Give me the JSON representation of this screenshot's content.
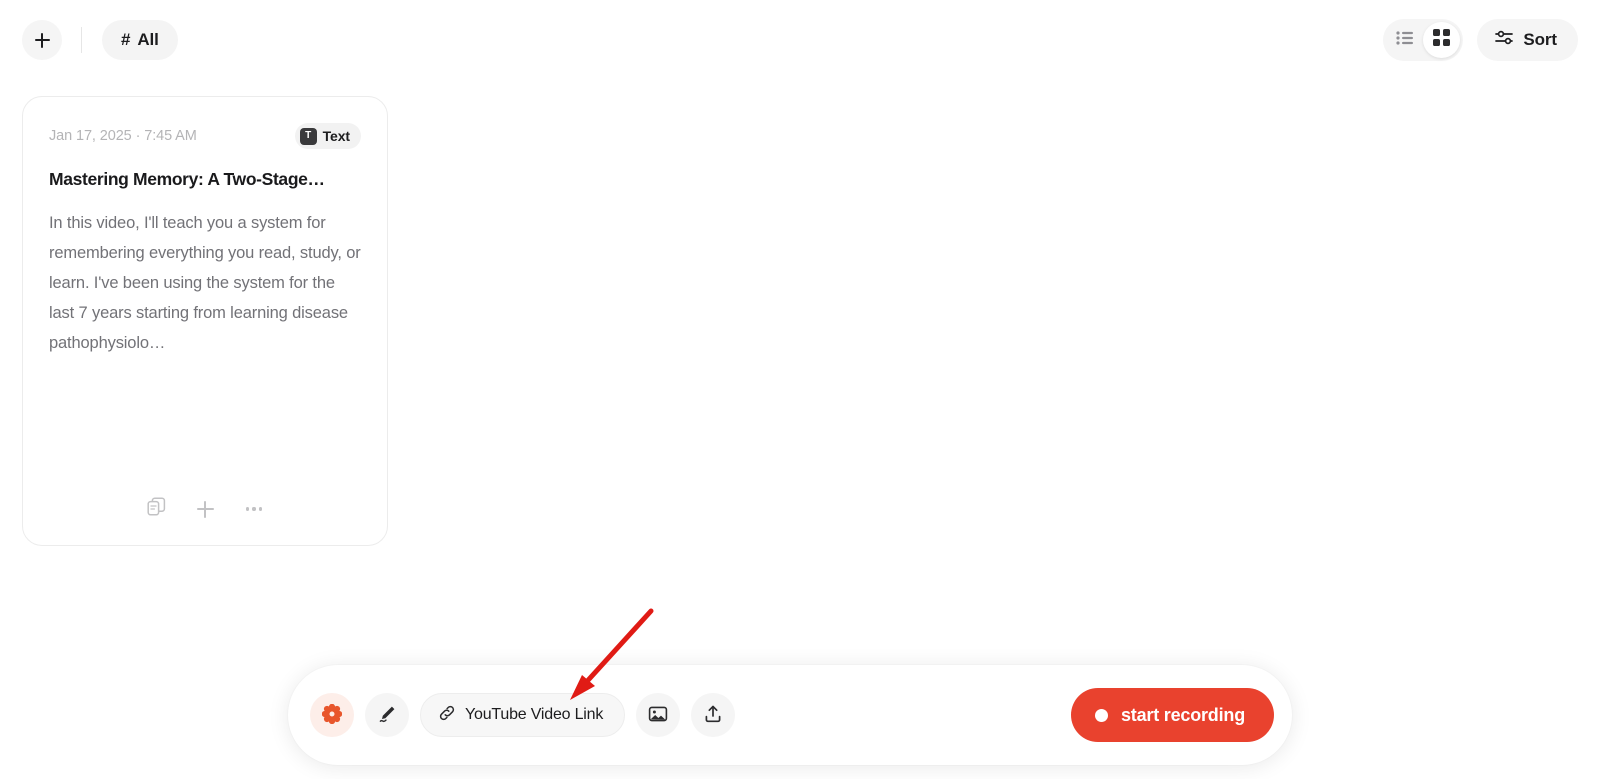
{
  "topbar": {
    "add_button": {
      "label": "+",
      "icon": "plus-icon"
    },
    "filter_chip": {
      "hash": "#",
      "label": "All"
    },
    "view_toggle": {
      "options": [
        {
          "id": "list",
          "icon": "list-view-icon",
          "active": false
        },
        {
          "id": "grid",
          "icon": "grid-view-icon",
          "active": true
        }
      ]
    },
    "sort_button": {
      "label": "Sort",
      "icon": "sliders-icon"
    }
  },
  "cards": [
    {
      "date": "Jan 17, 2025 · 7:45 AM",
      "badge": {
        "glyph": "T",
        "label": "Text",
        "icon": "text-type-icon"
      },
      "title": "Mastering Memory: A Two-Stage…",
      "body": "In this video, I'll teach you a system for remembering everything you read, study, or learn. I've been using the system for the last 7 years starting from learning disease pathophysiolo…",
      "footer_actions": [
        {
          "id": "duplicate",
          "icon": "copy-icon"
        },
        {
          "id": "add",
          "icon": "plus-icon"
        },
        {
          "id": "more",
          "icon": "ellipsis-icon"
        }
      ]
    }
  ],
  "toolbar": {
    "actions": [
      {
        "id": "magic",
        "icon": "flower-sparkle-icon"
      },
      {
        "id": "draw",
        "icon": "pen-icon"
      }
    ],
    "link_pill": {
      "label": "YouTube Video Link",
      "icon": "link-icon"
    },
    "media_actions": [
      {
        "id": "image",
        "icon": "image-icon"
      },
      {
        "id": "upload",
        "icon": "upload-icon"
      }
    ],
    "record_button": {
      "label": "start recording",
      "icon": "record-dot-icon"
    }
  },
  "annotation": {
    "arrow": {
      "color": "#e01b15",
      "points_to": "YouTube Video Link"
    }
  },
  "colors": {
    "accent_red": "#e9422e",
    "accent_orange": "#e8562c",
    "annotation_red": "#e01b15",
    "chip_gray": "#f4f4f4",
    "text_primary": "#1d1d1f",
    "text_secondary": "#727277",
    "text_muted": "#b4b4b6"
  }
}
